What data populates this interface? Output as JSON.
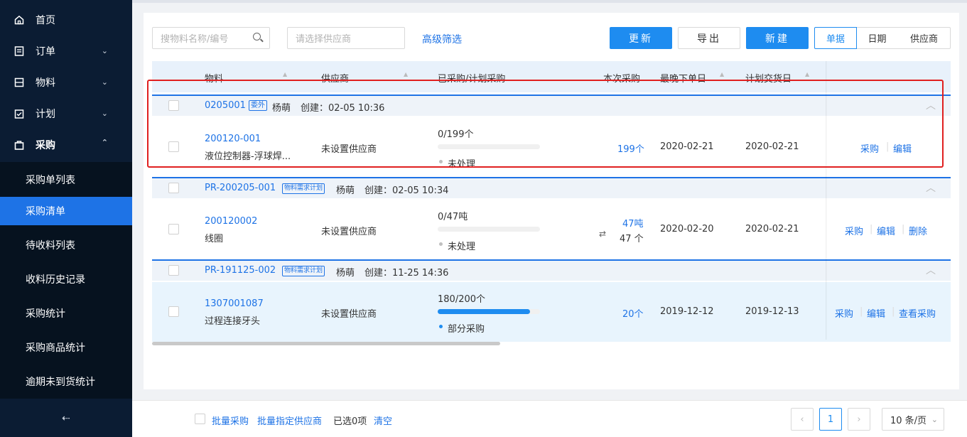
{
  "sidebar": {
    "items": [
      {
        "label": "首页",
        "icon": "home-icon"
      },
      {
        "label": "订单",
        "icon": "order-icon"
      },
      {
        "label": "物料",
        "icon": "material-icon"
      },
      {
        "label": "计划",
        "icon": "plan-icon"
      },
      {
        "label": "采购",
        "icon": "bag-icon"
      }
    ],
    "sub_items": [
      "采购单列表",
      "采购清单",
      "待收料列表",
      "收料历史记录",
      "采购统计",
      "采购商品统计",
      "逾期未到货统计"
    ],
    "active_sub": "采购清单",
    "collapse_label": "⇠"
  },
  "toolbar": {
    "search_placeholder": "搜物料名称/编号",
    "supplier_placeholder": "请选择供应商",
    "advanced_filter": "高级筛选",
    "refresh": "更新",
    "export": "导出",
    "create": "新建",
    "views": [
      "单据",
      "日期",
      "供应商"
    ],
    "active_view": "单据"
  },
  "table": {
    "columns": [
      "物料",
      "供应商",
      "已采购/计划采购",
      "本次采购",
      "最晚下单日",
      "计划交货日"
    ],
    "groups": [
      {
        "code": "0205001",
        "tag": "委外",
        "user": "杨萌",
        "created": "创建：02-05 10:36",
        "row": {
          "material_code": "200120-001",
          "material_name": "液位控制器-浮球焊...",
          "supplier": "未设置供应商",
          "progress_text": "0/199个",
          "progress": 0.0,
          "status": "未处理",
          "qty": "199个",
          "qty2": "",
          "latest_order": "2020-02-21",
          "delivery": "2020-02-21",
          "actions": [
            "采购",
            "编辑"
          ]
        }
      },
      {
        "code": "PR-200205-001",
        "tag": "物料需求计划",
        "user": "杨萌",
        "created": "创建：02-05 10:34",
        "row": {
          "material_code": "200120002",
          "material_name": "线圈",
          "supplier": "未设置供应商",
          "progress_text": "0/47吨",
          "progress": 0.0,
          "status": "未处理",
          "qty": "47吨",
          "qty2": "47 个",
          "latest_order": "2020-02-20",
          "delivery": "2020-02-21",
          "actions": [
            "采购",
            "编辑",
            "删除"
          ]
        }
      },
      {
        "code": "PR-191125-002",
        "tag": "物料需求计划",
        "user": "杨萌",
        "created": "创建：11-25 14:36",
        "row": {
          "material_code": "1307001087",
          "material_name": "过程连接牙头",
          "supplier": "未设置供应商",
          "progress_text": "180/200个",
          "progress": 0.9,
          "status": "部分采购",
          "qty": "20个",
          "qty2": "",
          "latest_order": "2019-12-12",
          "delivery": "2019-12-13",
          "actions": [
            "采购",
            "编辑",
            "查看采购"
          ]
        }
      }
    ]
  },
  "footer": {
    "batch_purchase": "批量采购",
    "batch_supplier": "批量指定供应商",
    "selected": "已选0项",
    "clear": "清空",
    "page": "1",
    "page_size": "10 条/页"
  },
  "colors": {
    "accent": "#1e8cf0",
    "sidebar": "#0b1c33",
    "highlight": "#e02020"
  }
}
